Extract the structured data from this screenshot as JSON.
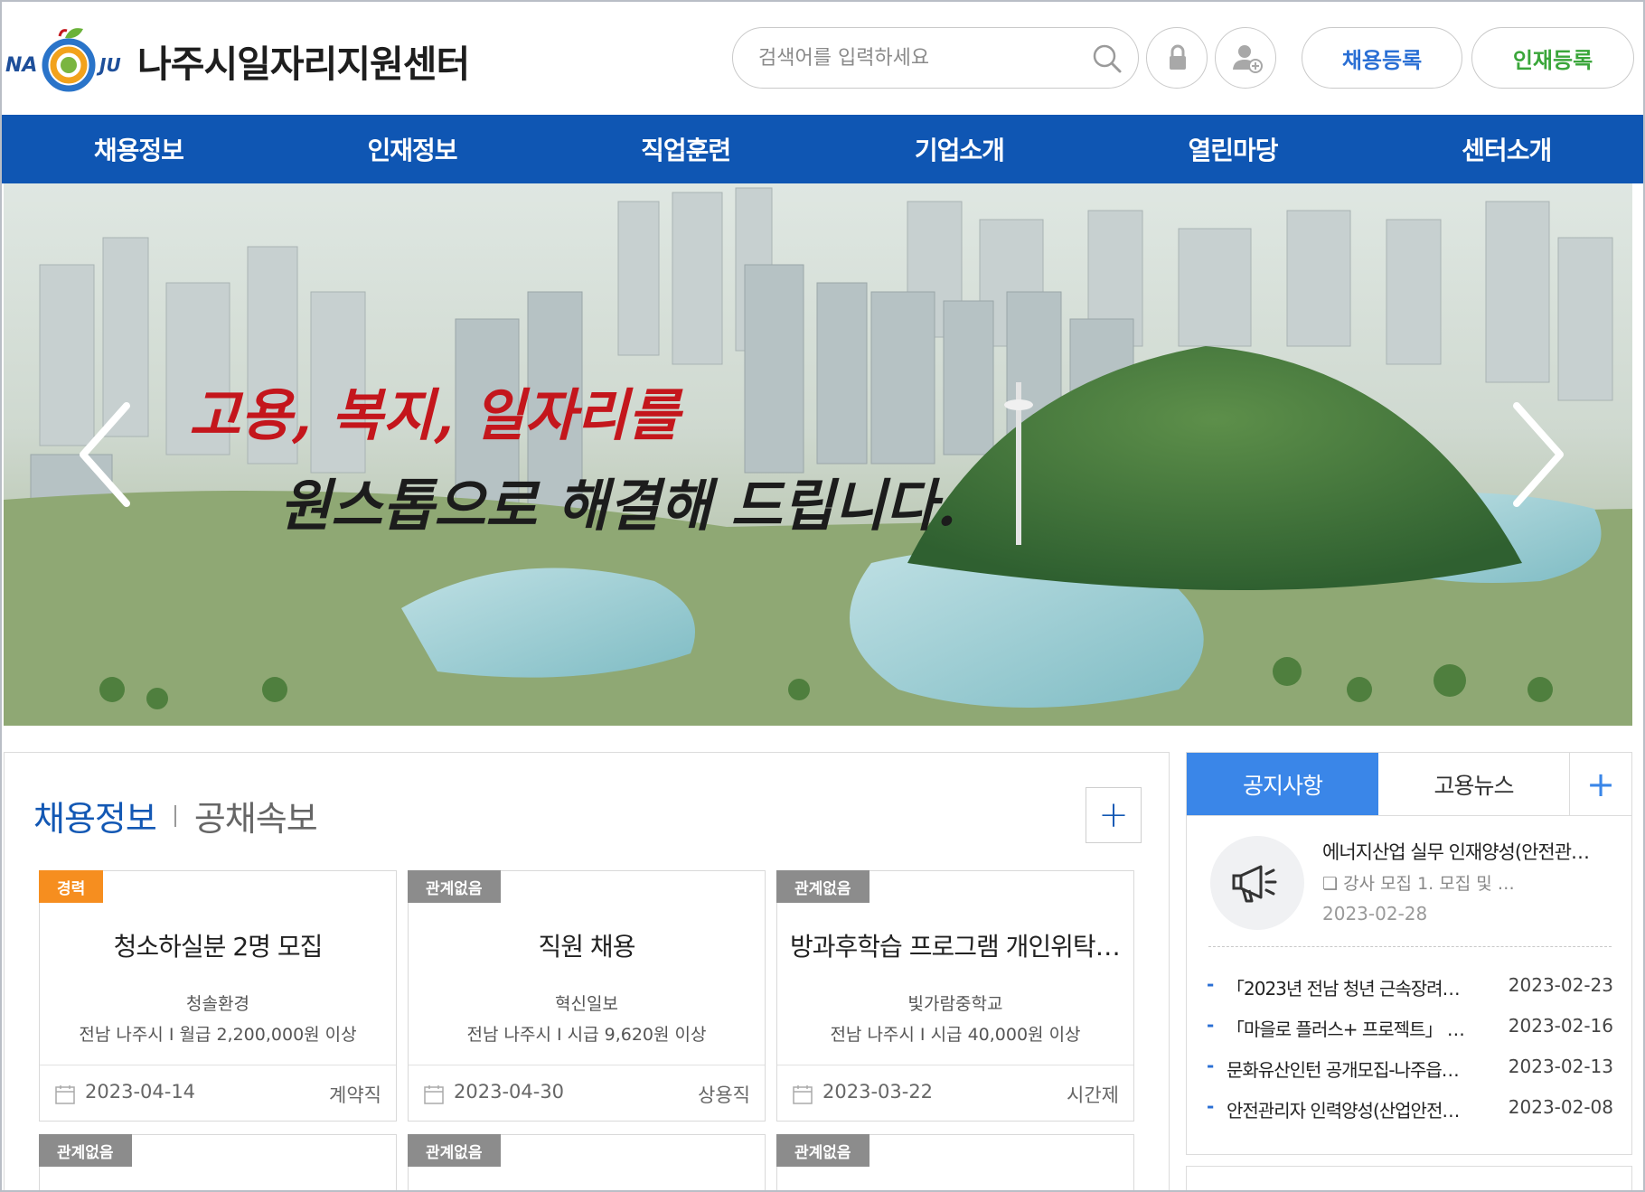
{
  "header": {
    "logo_left": "NA",
    "logo_right": "JU",
    "site_title": "나주시일자리지원센터",
    "search_placeholder": "검색어를 입력하세요",
    "btn_job_register": "채용등록",
    "btn_talent_register": "인재등록"
  },
  "nav": {
    "items": [
      "채용정보",
      "인재정보",
      "직업훈련",
      "기업소개",
      "열린마당",
      "센터소개"
    ]
  },
  "banner": {
    "line1": "고용, 복지, 일자리를",
    "line2": "원스톱으로 해결해 드립니다."
  },
  "jobs": {
    "title": "채용정보",
    "subtitle": "공채속보",
    "more": "+",
    "cards": [
      {
        "tag": "경력",
        "title": "청소하실분 2명 모집",
        "company": "청솔환경",
        "info": "전남 나주시 I 월급 2,200,000원 이상",
        "date": "2023-04-14",
        "type": "계약직"
      },
      {
        "tag": "관계없음",
        "title": "직원 채용",
        "company": "혁신일보",
        "info": "전남 나주시 I 시급 9,620원 이상",
        "date": "2023-04-30",
        "type": "상용직"
      },
      {
        "tag": "관계없음",
        "title": "방과후학습 프로그램 개인위탁 …",
        "company": "빛가람중학교",
        "info": "전남 나주시 I 시급 40,000원 이상",
        "date": "2023-03-22",
        "type": "시간제"
      },
      {
        "tag": "관계없음"
      },
      {
        "tag": "관계없음"
      },
      {
        "tag": "관계없음"
      }
    ]
  },
  "notice": {
    "tab_active": "공지사항",
    "tab_inactive": "고용뉴스",
    "more": "+",
    "featured": {
      "title": "에너지산업 실무 인재양성(안전관…",
      "desc": "❏ 강사 모집 1. 모집 및 …",
      "date": "2023-02-28"
    },
    "items": [
      {
        "text": "「2023년 전남 청년 근속장려금…",
        "date": "2023-02-23"
      },
      {
        "text": "「마을로 플러스+ 프로젝트」 청년…",
        "date": "2023-02-16"
      },
      {
        "text": "문화유산인턴 공개모집-나주읍…",
        "date": "2023-02-13"
      },
      {
        "text": "안전관리자 인력양성(산업안전…",
        "date": "2023-02-08"
      }
    ]
  },
  "colors": {
    "nav_blue": "#0f56b3",
    "accent_blue": "#3a86e8",
    "tag_orange": "#f68e1f",
    "tag_gray": "#8c8c8c",
    "banner_text_red": "#c4161c"
  },
  "icons": [
    "logo-mark",
    "search-icon",
    "lock-icon",
    "add-user-icon",
    "arrow-left-icon",
    "arrow-right-icon",
    "calendar-icon",
    "megaphone-icon",
    "plus-icon"
  ]
}
